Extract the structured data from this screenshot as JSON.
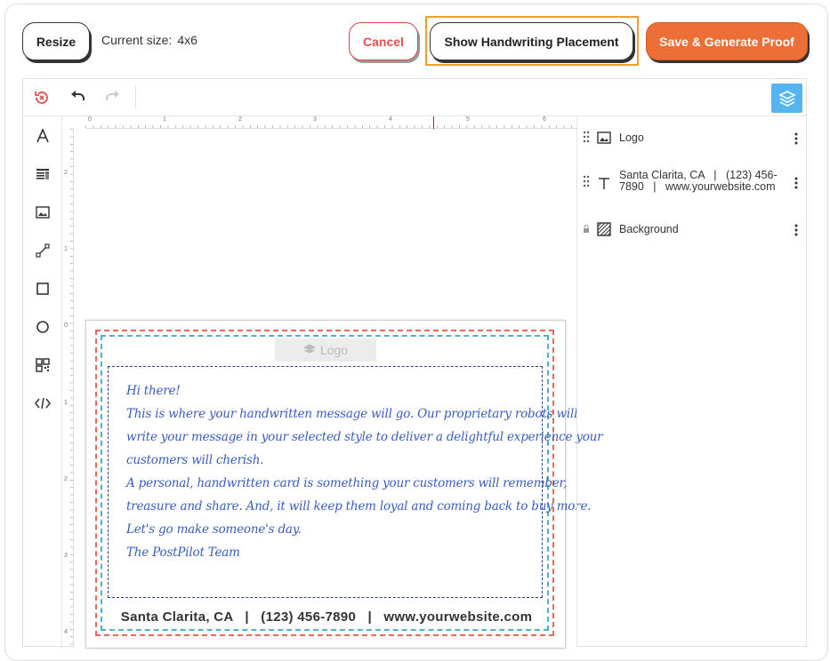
{
  "header": {
    "resize_label": "Resize",
    "size_label": "Current size:",
    "size_value": "4x6",
    "cancel_label": "Cancel",
    "handwriting_label": "Show Handwriting Placement",
    "save_label": "Save & Generate Proof"
  },
  "colors": {
    "accent": "#ee6f35",
    "cancel": "#e0504b",
    "highlight": "#f0a033",
    "layers_button": "#55b5f0",
    "bleed_line": "#e86a5c",
    "safe_line": "#4fb3c0",
    "handwriting": "#3a5dbb"
  },
  "toolbar": {
    "icons": [
      "reset-icon",
      "undo-icon",
      "redo-icon",
      "layers-icon"
    ]
  },
  "tools": [
    "text-tool",
    "textbox-tool",
    "image-tool",
    "line-tool",
    "rectangle-tool",
    "ellipse-tool",
    "qr-code-tool",
    "code-tool"
  ],
  "ruler": {
    "top_numbers": [
      "0",
      "1",
      "2",
      "3",
      "4",
      "5",
      "6"
    ],
    "left_numbers": [
      "2",
      "1",
      "0",
      "1",
      "2",
      "3",
      "4"
    ]
  },
  "card": {
    "logo_placeholder": "Logo",
    "message_lines": [
      "Hi there!",
      "This is where your handwritten message will go. Our proprietary robots will",
      "write your message in your selected style to deliver a delightful experience your",
      "customers will cherish.",
      "A personal, handwritten card is something your customers will remember,",
      "treasure and share. And, it will keep them loyal and coming back to buy more.",
      "Let's go make someone's day.",
      "The PostPilot Team"
    ],
    "footer": "Santa Clarita, CA   |   (123) 456-7890   |   www.yourwebsite.com"
  },
  "layers": [
    {
      "label": "Logo",
      "icon": "image-icon",
      "locked": false
    },
    {
      "label_line1": "Santa Clarita, CA   |   (123) 456-",
      "label_line2": "7890   |   www.yourwebsite.com",
      "icon": "text-icon",
      "locked": false
    },
    {
      "label": "Background",
      "icon": "background-icon",
      "locked": true
    }
  ]
}
